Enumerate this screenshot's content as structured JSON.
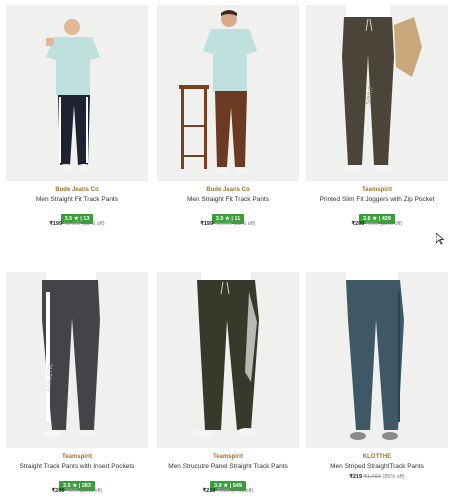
{
  "products": [
    {
      "brand": "Bude Jeans Co",
      "title": "Men Straight Fit Track Pants",
      "rating": "3.5 ★ | 13",
      "price_now": "₹199",
      "price_was": "₹1,099",
      "discount": "(82% off)",
      "pants_color": "#1e2233",
      "shirt_color": "#bfe0dc"
    },
    {
      "brand": "Bude Jeans Co",
      "title": "Men Straight Fit Track Pants",
      "rating": "3.5 ★ | 11",
      "price_now": "₹199",
      "price_was": "₹1,099",
      "discount": "(82% off)",
      "pants_color": "#6a3a22",
      "shirt_color": "#bfe0dc"
    },
    {
      "brand": "Teamspirit",
      "title": "Printed Slim Fit Joggers with Zip Pocket",
      "rating": "3.6 ★ | 429",
      "price_now": "₹200",
      "price_was": "₹800",
      "discount": "(80% off)",
      "pants_color": "#4a4538",
      "shirt_color": "#ffffff"
    },
    {
      "brand": "Teamspirit",
      "title": "Straight Track Pants with Insert Pockets",
      "rating": "3.5 ★ | 283",
      "price_now": "₹200",
      "price_was": "₹800",
      "discount": "(80% off)",
      "pants_color": "#444448",
      "shirt_color": "#ffffff"
    },
    {
      "brand": "Teamspirit",
      "title": "Men Strucutre Panel Straight Track Pants",
      "rating": "3.9 ★ | 549",
      "price_now": "₹210",
      "price_was": "₹800",
      "discount": "(74% off)",
      "pants_color": "#363a2a",
      "shirt_color": "#ffffff"
    },
    {
      "brand": "KLOTTHE",
      "title": "Men Striped StraightTrack Pants",
      "rating": "",
      "price_now": "₹219",
      "price_was": "₹1,499",
      "discount": "(85% off)",
      "pants_color": "#3e5866",
      "shirt_color": "#ffffff"
    }
  ],
  "icons": {
    "cursor": "mouse-pointer-icon"
  }
}
